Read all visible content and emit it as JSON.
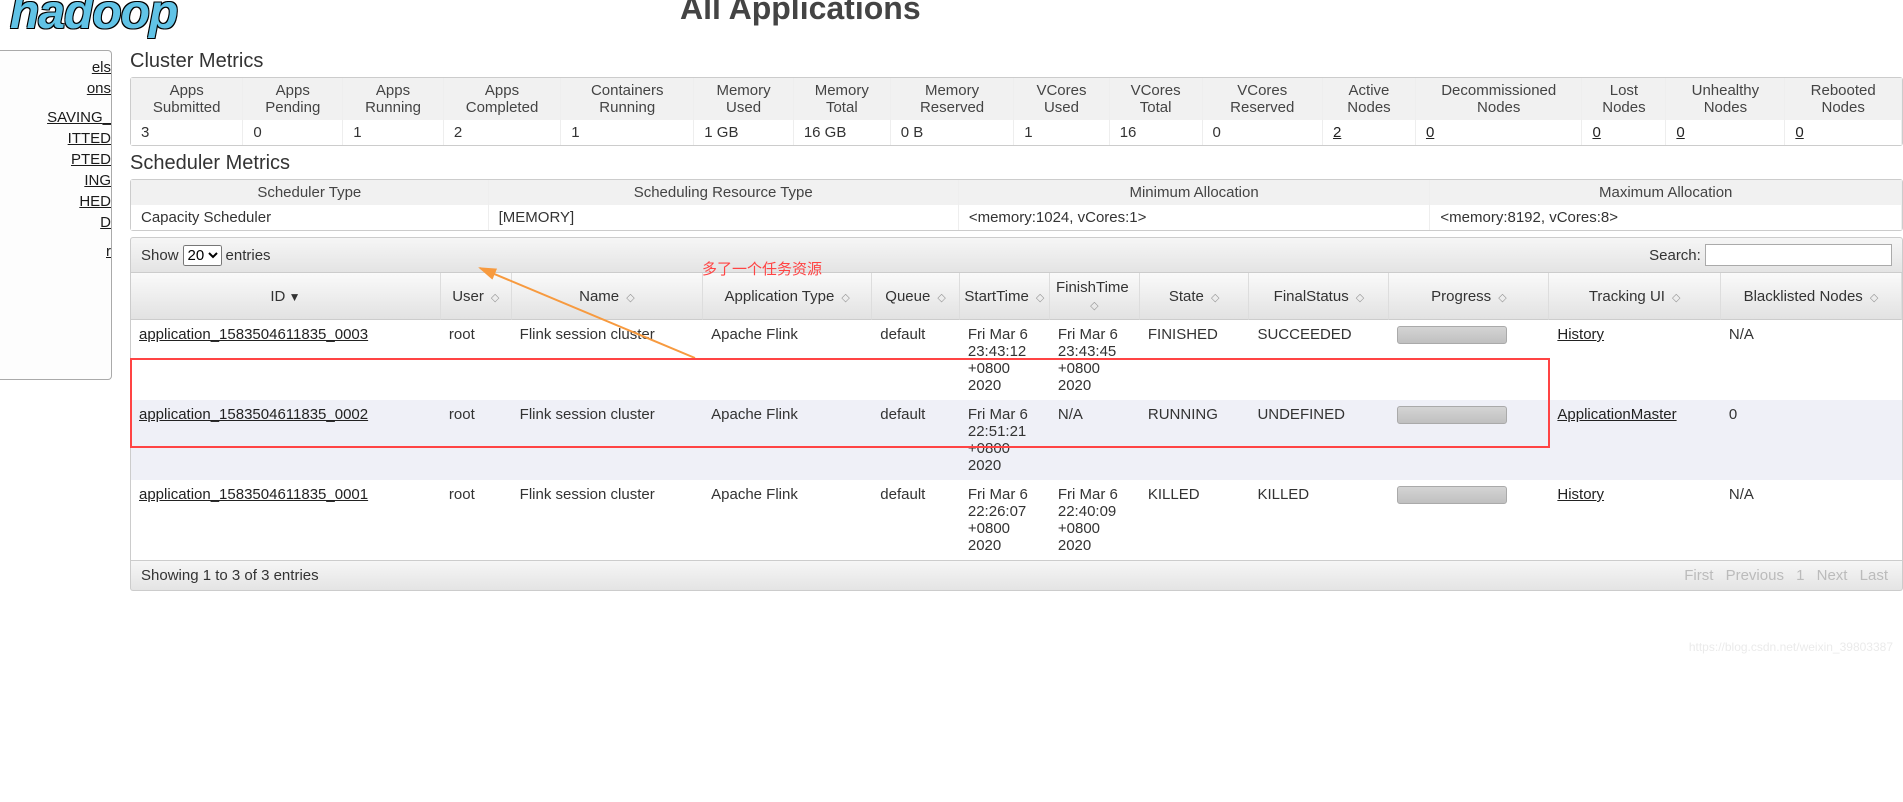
{
  "logo": "hadoop",
  "page_title": "All Applications",
  "sidebar": {
    "items": [
      {
        "label": "els"
      },
      {
        "label": "ons"
      },
      {
        "label": ""
      },
      {
        "label": "_SAVING"
      },
      {
        "label": "ITTED"
      },
      {
        "label": "PTED"
      },
      {
        "label": "ING"
      },
      {
        "label": "HED"
      },
      {
        "label": "D"
      },
      {
        "label": ""
      },
      {
        "label": "r"
      }
    ]
  },
  "cluster_metrics": {
    "title": "Cluster Metrics",
    "headers": [
      "Apps Submitted",
      "Apps Pending",
      "Apps Running",
      "Apps Completed",
      "Containers Running",
      "Memory Used",
      "Memory Total",
      "Memory Reserved",
      "VCores Used",
      "VCores Total",
      "VCores Reserved",
      "Active Nodes",
      "Decommissioned Nodes",
      "Lost Nodes",
      "Unhealthy Nodes",
      "Rebooted Nodes"
    ],
    "values": [
      "3",
      "0",
      "1",
      "2",
      "1",
      "1 GB",
      "16 GB",
      "0 B",
      "1",
      "16",
      "0",
      "2",
      "0",
      "0",
      "0",
      "0"
    ],
    "links": [
      false,
      false,
      false,
      false,
      false,
      false,
      false,
      false,
      false,
      false,
      false,
      true,
      true,
      true,
      true,
      true
    ]
  },
  "scheduler_metrics": {
    "title": "Scheduler Metrics",
    "headers": [
      "Scheduler Type",
      "Scheduling Resource Type",
      "Minimum Allocation",
      "Maximum Allocation"
    ],
    "values": [
      "Capacity Scheduler",
      "[MEMORY]",
      "<memory:1024, vCores:1>",
      "<memory:8192, vCores:8>"
    ]
  },
  "datatable": {
    "show_label": "Show",
    "entries_label": "entries",
    "show_value": "20",
    "search_label": "Search:",
    "info": "Showing 1 to 3 of 3 entries",
    "paginate": {
      "first": "First",
      "prev": "Previous",
      "page": "1",
      "next": "Next",
      "last": "Last"
    }
  },
  "apps": {
    "headers": [
      "ID",
      "User",
      "Name",
      "Application Type",
      "Queue",
      "StartTime",
      "FinishTime",
      "State",
      "FinalStatus",
      "Progress",
      "Tracking UI",
      "Blacklisted Nodes"
    ],
    "rows": [
      {
        "id": "application_1583504611835_0003",
        "user": "root",
        "name": "Flink session cluster",
        "type": "Apache Flink",
        "queue": "default",
        "start": "Fri Mar 6 23:43:12 +0800 2020",
        "finish": "Fri Mar 6 23:43:45 +0800 2020",
        "state": "FINISHED",
        "final": "SUCCEEDED",
        "tracking": "History",
        "blacklist": "N/A"
      },
      {
        "id": "application_1583504611835_0002",
        "user": "root",
        "name": "Flink session cluster",
        "type": "Apache Flink",
        "queue": "default",
        "start": "Fri Mar 6 22:51:21 +0800 2020",
        "finish": "N/A",
        "state": "RUNNING",
        "final": "UNDEFINED",
        "tracking": "ApplicationMaster",
        "blacklist": "0"
      },
      {
        "id": "application_1583504611835_0001",
        "user": "root",
        "name": "Flink session cluster",
        "type": "Apache Flink",
        "queue": "default",
        "start": "Fri Mar 6 22:26:07 +0800 2020",
        "finish": "Fri Mar 6 22:40:09 +0800 2020",
        "state": "KILLED",
        "final": "KILLED",
        "tracking": "History",
        "blacklist": "N/A"
      }
    ]
  },
  "annotation": "多了一个任务资源",
  "watermark": "https://blog.csdn.net/weixin_39803387"
}
